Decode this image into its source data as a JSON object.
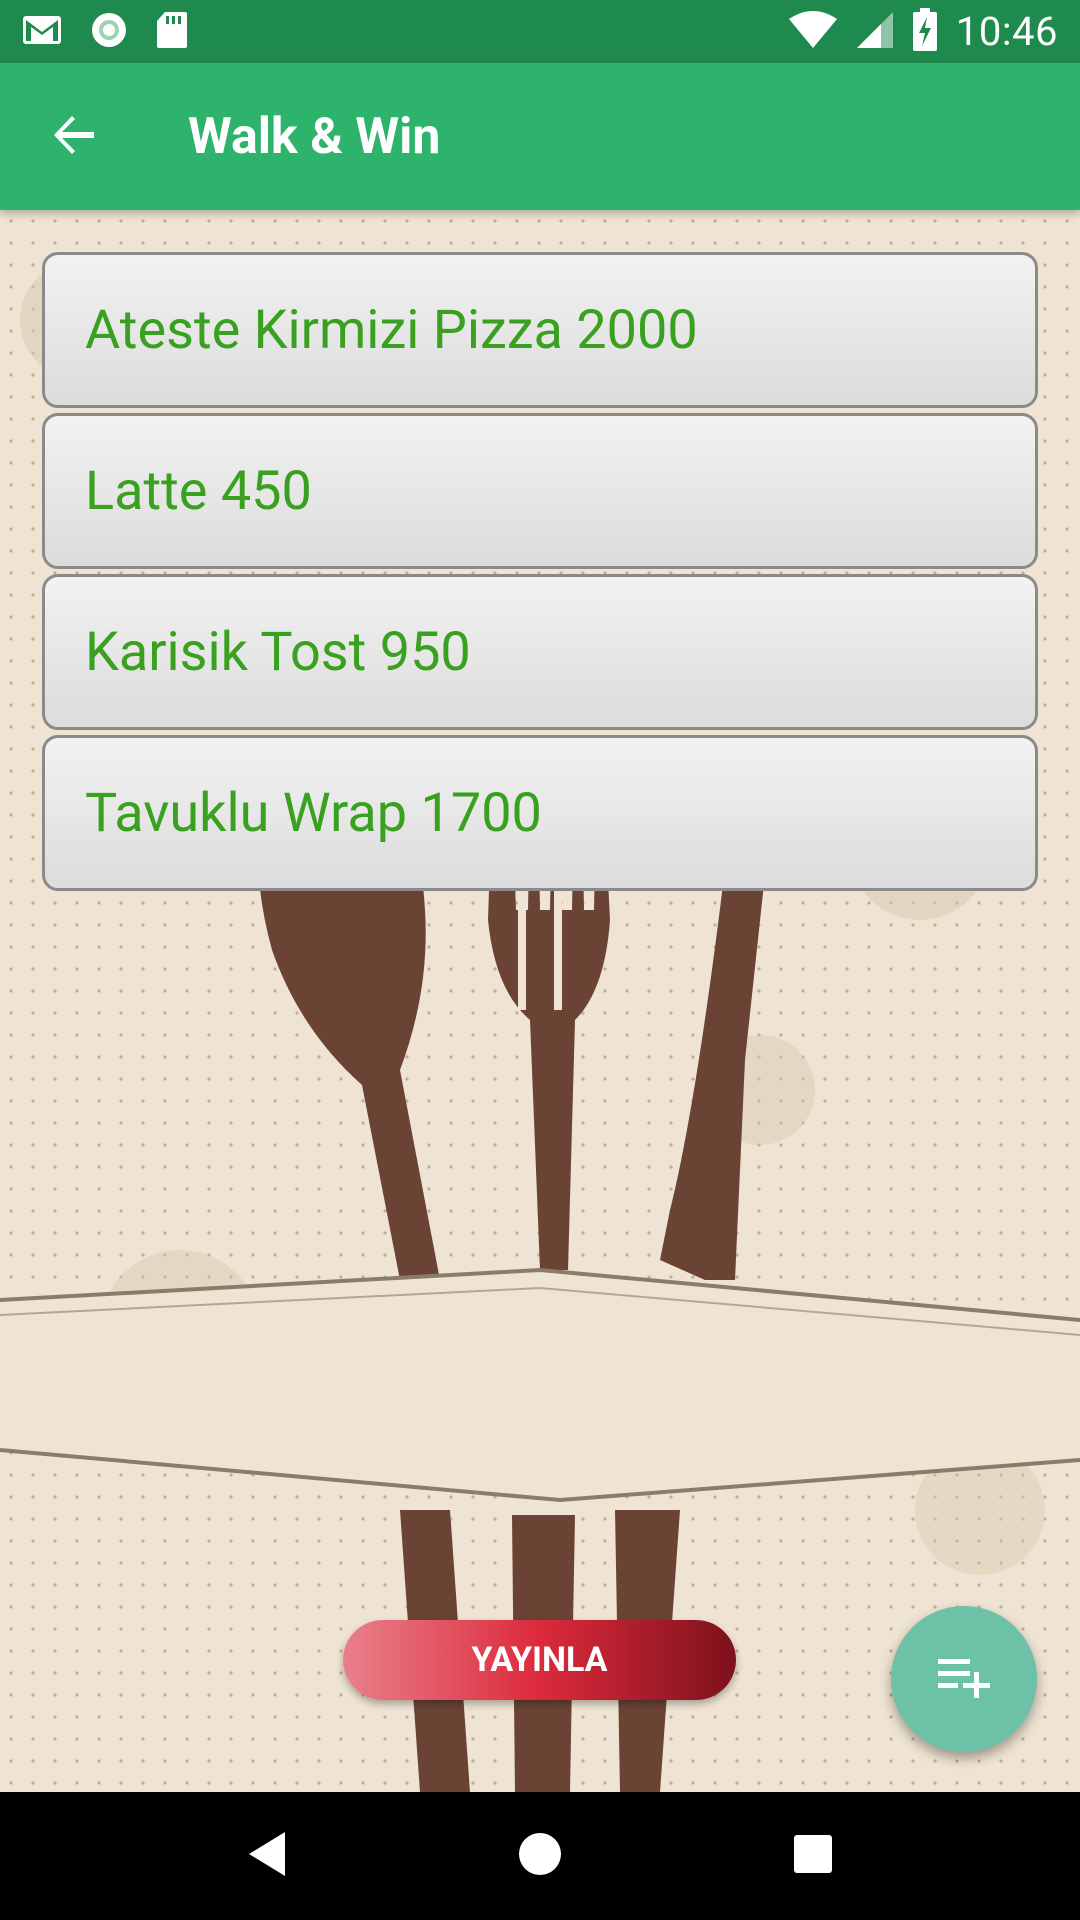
{
  "status_bar": {
    "time": "10:46",
    "icons": [
      "gmail-icon",
      "circle-app-icon",
      "sd-card-icon",
      "wifi-icon",
      "signal-icon",
      "battery-charging-icon"
    ]
  },
  "app_bar": {
    "title": "Walk & Win",
    "back_icon": "arrow-left-icon"
  },
  "menu": {
    "items": [
      {
        "label": "Ateste Kirmizi Pizza 2000"
      },
      {
        "label": "Latte 450"
      },
      {
        "label": "Karisik Tost 950"
      },
      {
        "label": "Tavuklu Wrap 1700"
      }
    ]
  },
  "actions": {
    "publish_label": "YAYINLA",
    "fab_icon": "playlist-add-icon"
  },
  "nav_bar": {
    "icons": [
      "back-triangle-icon",
      "home-circle-icon",
      "recents-square-icon"
    ]
  },
  "colors": {
    "status_bar": "#1f8a4e",
    "app_bar": "#2db36c",
    "item_text": "#3aa01f",
    "publish_start": "#e9808a",
    "publish_mid": "#dc2a3c",
    "publish_end": "#7d111c",
    "fab": "#6cc1a7"
  }
}
